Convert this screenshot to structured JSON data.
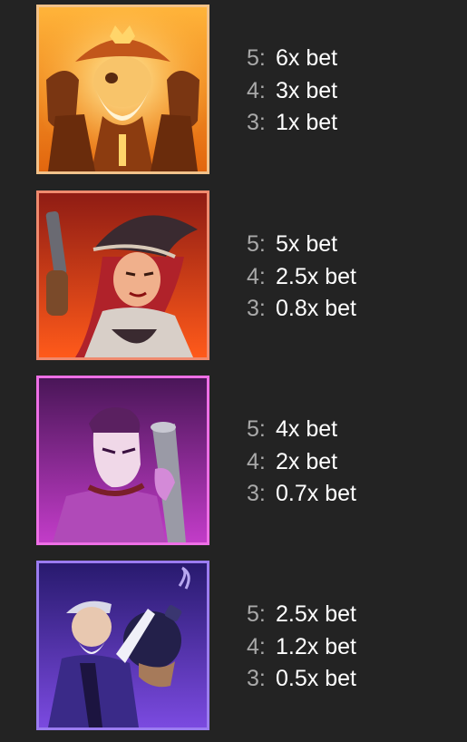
{
  "symbols": [
    {
      "icon": "pirate-king-icon",
      "colors": {
        "border": "#f2c28a",
        "bg_top": "#ffb43a",
        "bg_bottom": "#e2660e"
      },
      "payouts": [
        {
          "count": "5:",
          "value": "6x bet"
        },
        {
          "count": "4:",
          "value": "3x bet"
        },
        {
          "count": "3:",
          "value": "1x bet"
        }
      ]
    },
    {
      "icon": "pirate-woman-icon",
      "colors": {
        "border": "#ef8a6e",
        "bg_top": "#8f1c14",
        "bg_bottom": "#ff5a1a"
      },
      "payouts": [
        {
          "count": "5:",
          "value": "5x bet"
        },
        {
          "count": "4:",
          "value": "2.5x bet"
        },
        {
          "count": "3:",
          "value": "0.8x bet"
        }
      ]
    },
    {
      "icon": "pirate-gunner-icon",
      "colors": {
        "border": "#ee6fe6",
        "bg_top": "#4a1658",
        "bg_bottom": "#c23cc8"
      },
      "payouts": [
        {
          "count": "5:",
          "value": "4x bet"
        },
        {
          "count": "4:",
          "value": "2x bet"
        },
        {
          "count": "3:",
          "value": "0.7x bet"
        }
      ]
    },
    {
      "icon": "old-pirate-bomb-icon",
      "colors": {
        "border": "#9b7cf0",
        "bg_top": "#281a6e",
        "bg_bottom": "#7b4ae0"
      },
      "payouts": [
        {
          "count": "5:",
          "value": "2.5x bet"
        },
        {
          "count": "4:",
          "value": "1.2x bet"
        },
        {
          "count": "3:",
          "value": "0.5x bet"
        }
      ]
    }
  ]
}
